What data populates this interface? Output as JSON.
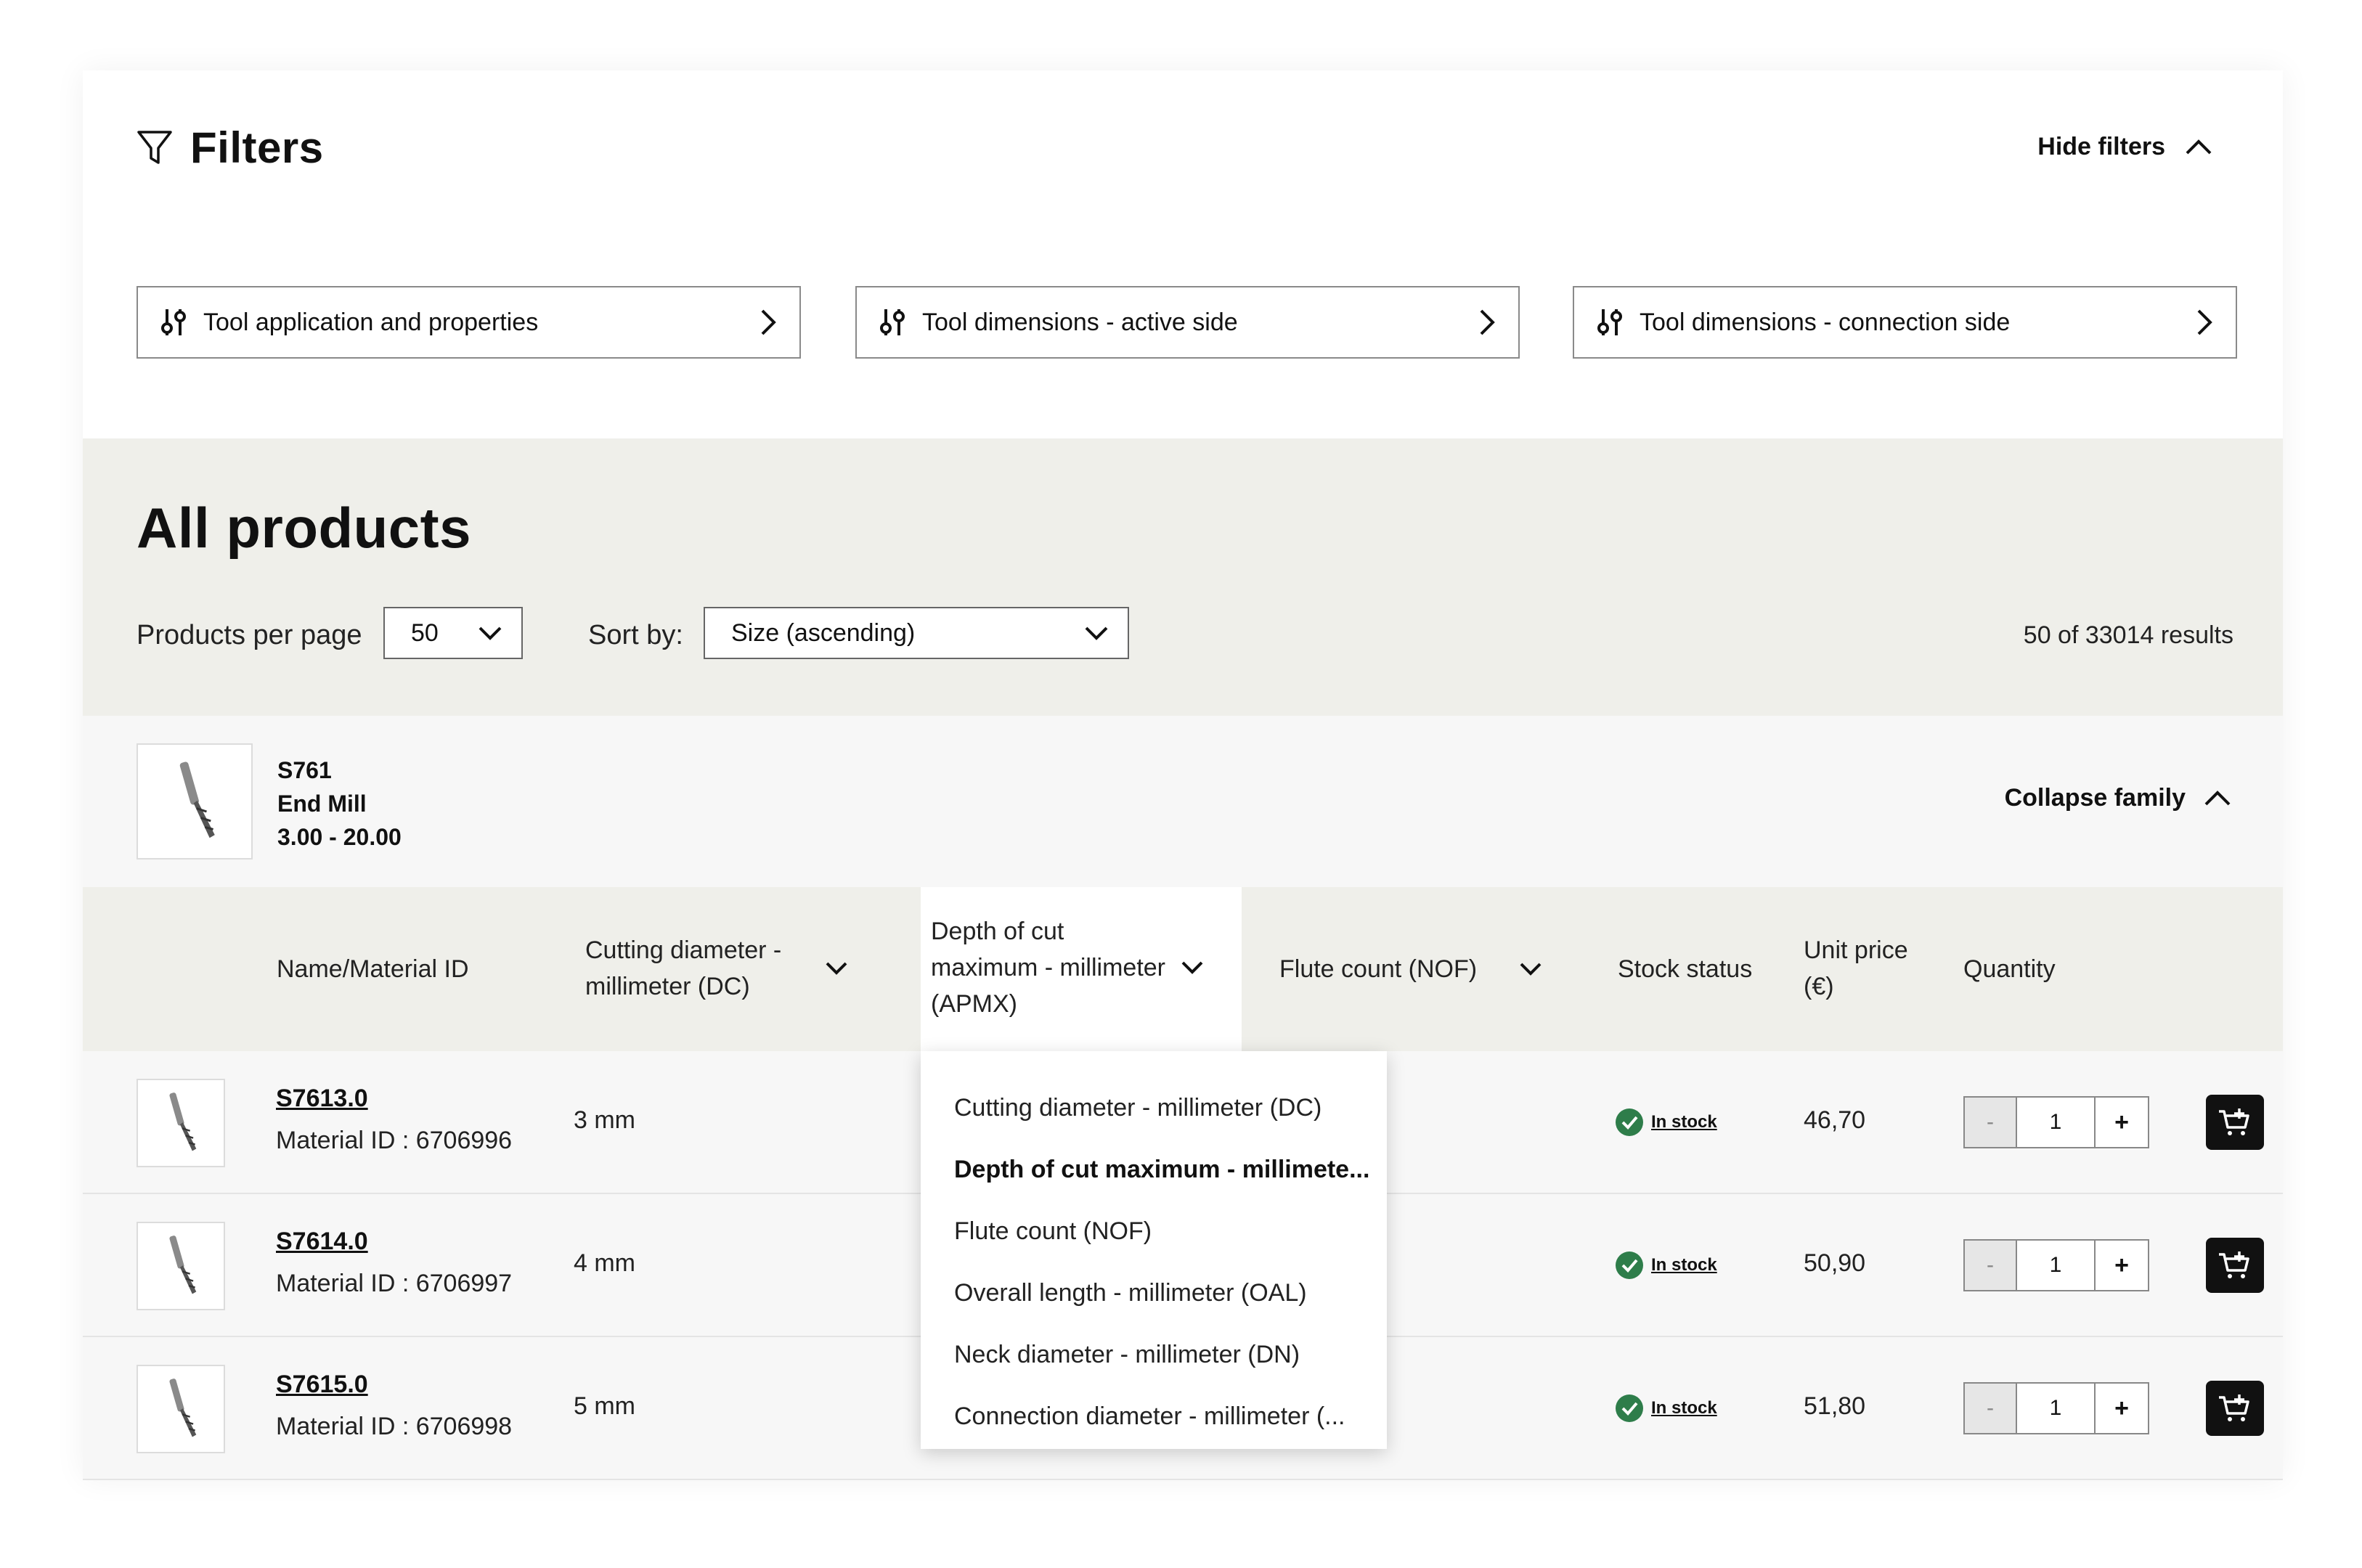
{
  "filters": {
    "title": "Filters",
    "hide_label": "Hide filters",
    "buttons": [
      {
        "label": "Tool application and properties"
      },
      {
        "label": "Tool dimensions - active side"
      },
      {
        "label": "Tool dimensions - connection side"
      }
    ]
  },
  "products": {
    "title": "All products",
    "per_page_label": "Products per page",
    "per_page_value": "50",
    "sort_label": "Sort by:",
    "sort_value": "Size (ascending)",
    "results": "50 of 33014 results"
  },
  "family": {
    "code": "S761",
    "name": "End Mill",
    "range": "3.00 - 20.00",
    "collapse_label": "Collapse family"
  },
  "table": {
    "headers": {
      "name": "Name/Material ID",
      "dc_line1": "Cutting diameter -",
      "dc_line2": "millimeter (DC)",
      "apmx_line1": "Depth of cut",
      "apmx_line2": "maximum - millimeter",
      "apmx_line3": "(APMX)",
      "nof": "Flute count (NOF)",
      "stock": "Stock status",
      "price_line1": "Unit price",
      "price_line2": "(€)",
      "quantity": "Quantity"
    },
    "rows": [
      {
        "name": "S7613.0",
        "material": "Material ID : 6706996",
        "dc": "3 mm",
        "stock": "In stock",
        "price": "46,70",
        "qty_minus": "-",
        "qty": "1",
        "qty_plus": "+"
      },
      {
        "name": "S7614.0",
        "material": "Material ID : 6706997",
        "dc": "4 mm",
        "stock": "In stock",
        "price": "50,90",
        "qty_minus": "-",
        "qty": "1",
        "qty_plus": "+"
      },
      {
        "name": "S7615.0",
        "material": "Material ID : 6706998",
        "dc": "5 mm",
        "stock": "In stock",
        "price": "51,80",
        "qty_minus": "-",
        "qty": "1",
        "qty_plus": "+"
      }
    ]
  },
  "dropdown": {
    "items": [
      {
        "label": "Cutting diameter - millimeter (DC)"
      },
      {
        "label": "Depth of cut maximum - millimete..."
      },
      {
        "label": "Flute count (NOF)"
      },
      {
        "label": "Overall length - millimeter (OAL)"
      },
      {
        "label": "Neck diameter - millimeter (DN)"
      },
      {
        "label": "Connection diameter - millimeter (..."
      }
    ],
    "active_index": 1
  },
  "colors": {
    "accent_dark": "#111111",
    "panel_bg": "#efefea",
    "row_bg": "#f7f7f7",
    "stock_green": "#2e7d4a"
  }
}
